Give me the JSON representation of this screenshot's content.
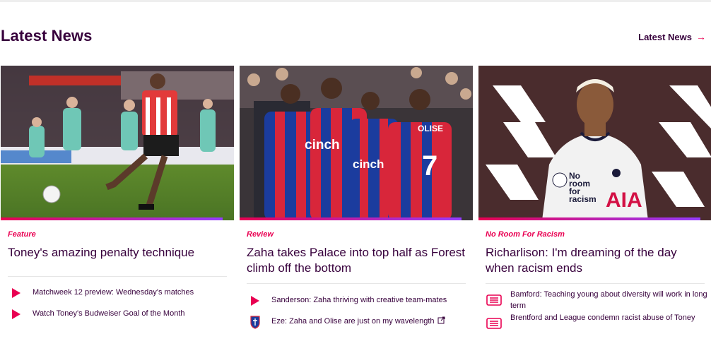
{
  "header": {
    "title": "Latest News",
    "link_label": "Latest News",
    "link_arrow": "→"
  },
  "colors": {
    "accent": "#e90052",
    "brand": "#37003c",
    "gradient_end": "#963cff"
  },
  "cards": [
    {
      "tag": "Feature",
      "title": "Toney's amazing penalty technique",
      "related": [
        {
          "icon": "play-icon",
          "text": "Matchweek 12 preview: Wednesday's matches"
        },
        {
          "icon": "play-icon",
          "text": "Watch Toney's Budweiser Goal of the Month"
        }
      ]
    },
    {
      "tag": "Review",
      "title": "Zaha takes Palace into top half as Forest climb off the bottom",
      "related": [
        {
          "icon": "play-icon",
          "text": "Sanderson: Zaha thriving with creative team-mates"
        },
        {
          "icon": "club-crest-icon",
          "text": "Eze: Zaha and Olise are just on my wavelength",
          "external": true
        }
      ]
    },
    {
      "tag": "No Room For Racism",
      "title": "Richarlison: I'm dreaming of the day when racism ends",
      "related": [
        {
          "icon": "article-icon",
          "text": "Bamford: Teaching young about diversity will work in long term"
        },
        {
          "icon": "article-icon",
          "text": "Brentford and League condemn racist abuse of Toney"
        }
      ]
    }
  ],
  "image_text": {
    "card2": [
      "cinch",
      "cinch",
      "OLISE",
      "7"
    ],
    "card3": [
      "No",
      "room",
      "for",
      "racism",
      "AIA"
    ]
  }
}
